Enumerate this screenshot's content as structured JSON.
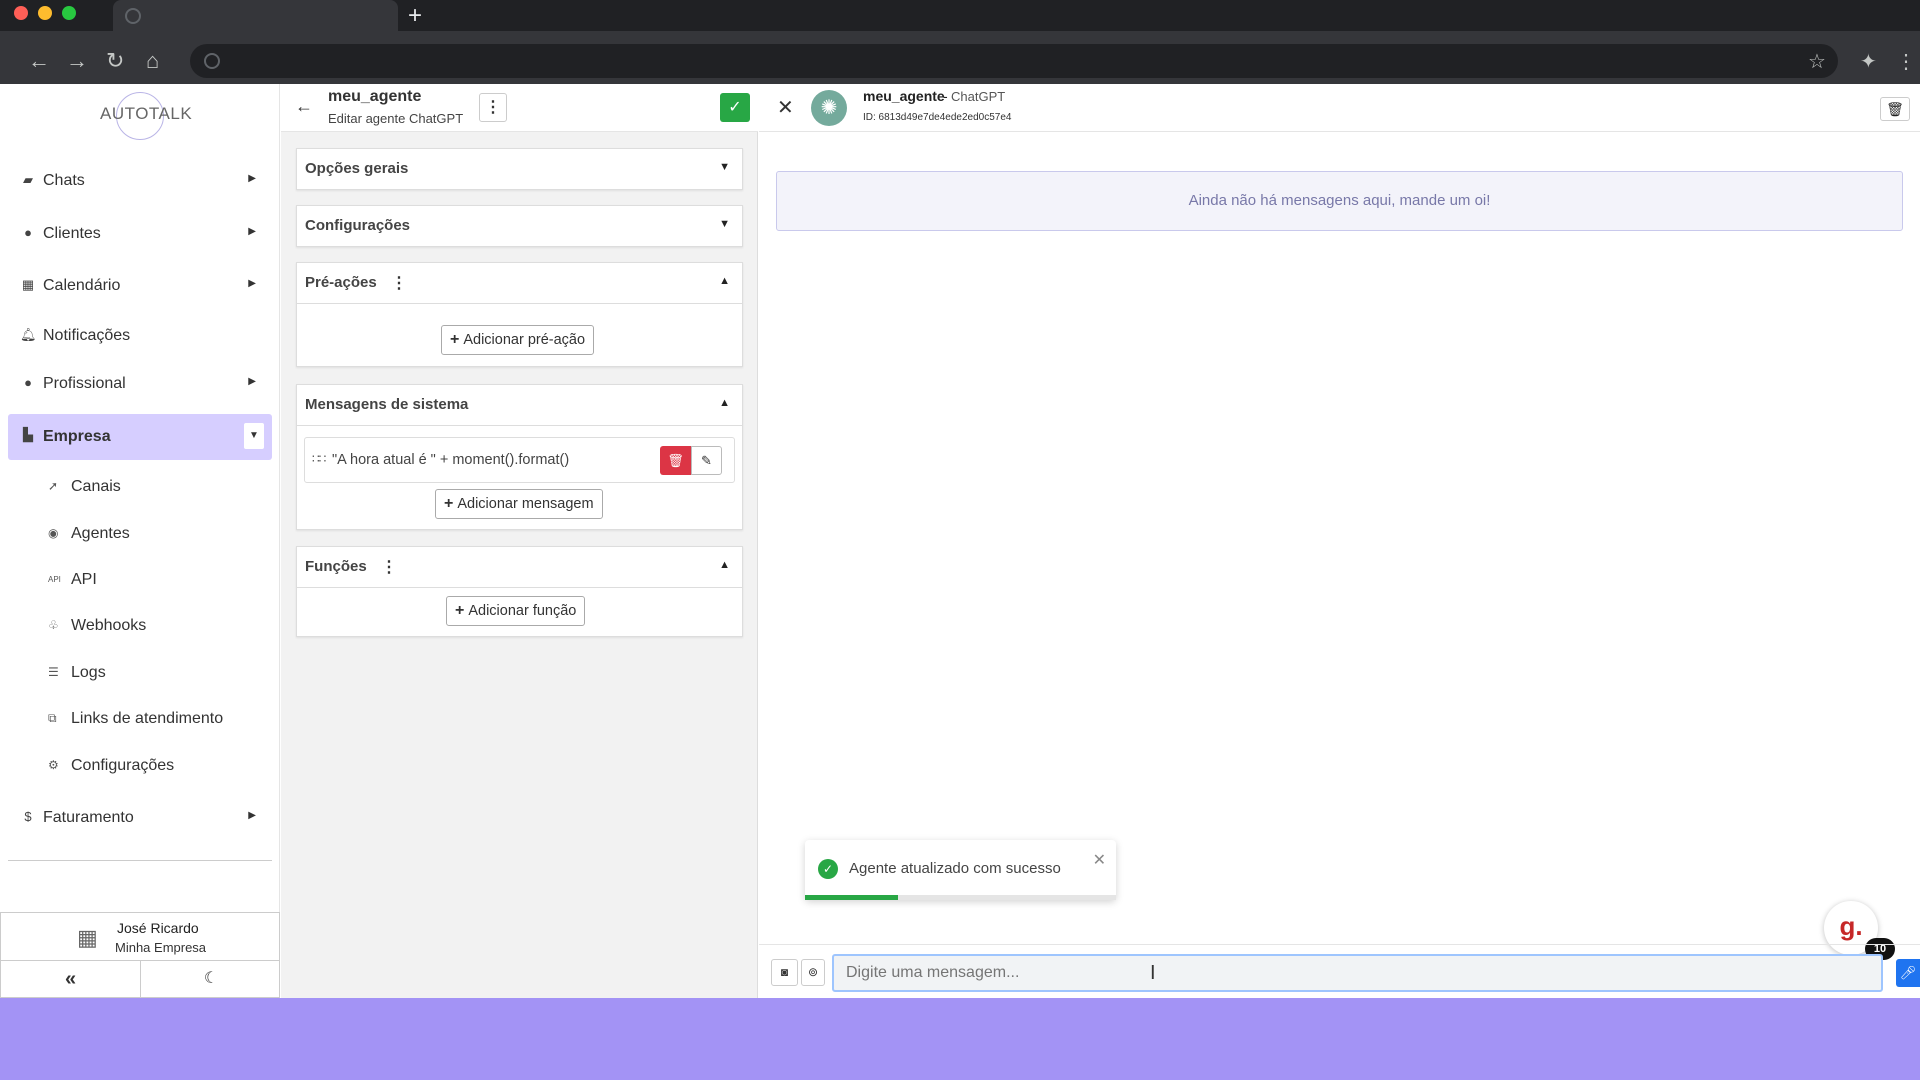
{
  "browser": {
    "traffic_colors": [
      "#ff5f57",
      "#febc2e",
      "#28c840"
    ],
    "new_tab": "+",
    "nav": {
      "back": "←",
      "forward": "→",
      "reload": "↻",
      "home": "⌂"
    },
    "right_icons": [
      "star-icon",
      "extensions-icon",
      "menu-icon"
    ]
  },
  "sidebar": {
    "logo": "AUTOTALK",
    "items": [
      {
        "label": "Chats",
        "icon": "chat-icon"
      },
      {
        "label": "Clientes",
        "icon": "users-icon"
      },
      {
        "label": "Calendário",
        "icon": "calendar-icon"
      },
      {
        "label": "Notificações",
        "icon": "bell-icon"
      },
      {
        "label": "Profissional",
        "icon": "user-gear-icon"
      },
      {
        "label": "Empresa",
        "icon": "building-icon",
        "active": true
      },
      {
        "label": "Faturamento",
        "icon": "dollar-icon"
      }
    ],
    "subitems": [
      {
        "label": "Canais",
        "icon": "rocket-icon"
      },
      {
        "label": "Agentes",
        "icon": "robot-icon"
      },
      {
        "label": "API",
        "icon": "api-icon"
      },
      {
        "label": "Webhooks",
        "icon": "webhook-icon"
      },
      {
        "label": "Logs",
        "icon": "list-icon"
      },
      {
        "label": "Links de atendimento",
        "icon": "external-link-icon"
      },
      {
        "label": "Configurações",
        "icon": "gear-icon"
      }
    ],
    "user": {
      "name": "José Ricardo",
      "company": "Minha Empresa"
    },
    "collapse": "«",
    "theme": "☾"
  },
  "editor": {
    "title": "meu_agente",
    "subtitle": "Editar agente ChatGPT",
    "panels": {
      "opcoes": "Opções gerais",
      "config": "Configurações",
      "pre": "Pré-ações",
      "sistema": "Mensagens de sistema",
      "funcoes": "Funções"
    },
    "buttons": {
      "add_pre": "Adicionar pré-ação",
      "add_msg": "Adicionar mensagem",
      "add_func": "Adicionar função"
    },
    "system_message": "\"A hora atual é \" + moment().format()"
  },
  "chat": {
    "agent_name": "meu_agente",
    "model": "ChatGPT",
    "id": "ID: 6813d49e7de4ede2ed0c57e4",
    "empty_text": "Ainda não há mensagens aqui, mande um oi!",
    "input_placeholder": "Digite uma mensagem...",
    "toast": {
      "text": "Agente atualizado com sucesso",
      "progress_pct": 30,
      "color": "#28a745"
    },
    "widget": {
      "letter": "g.",
      "badge": "10"
    }
  },
  "colors": {
    "accent": "#d6ceff",
    "background": "#a393f5",
    "danger": "#dc3545",
    "success": "#28a745",
    "send": "#1f74f0"
  }
}
